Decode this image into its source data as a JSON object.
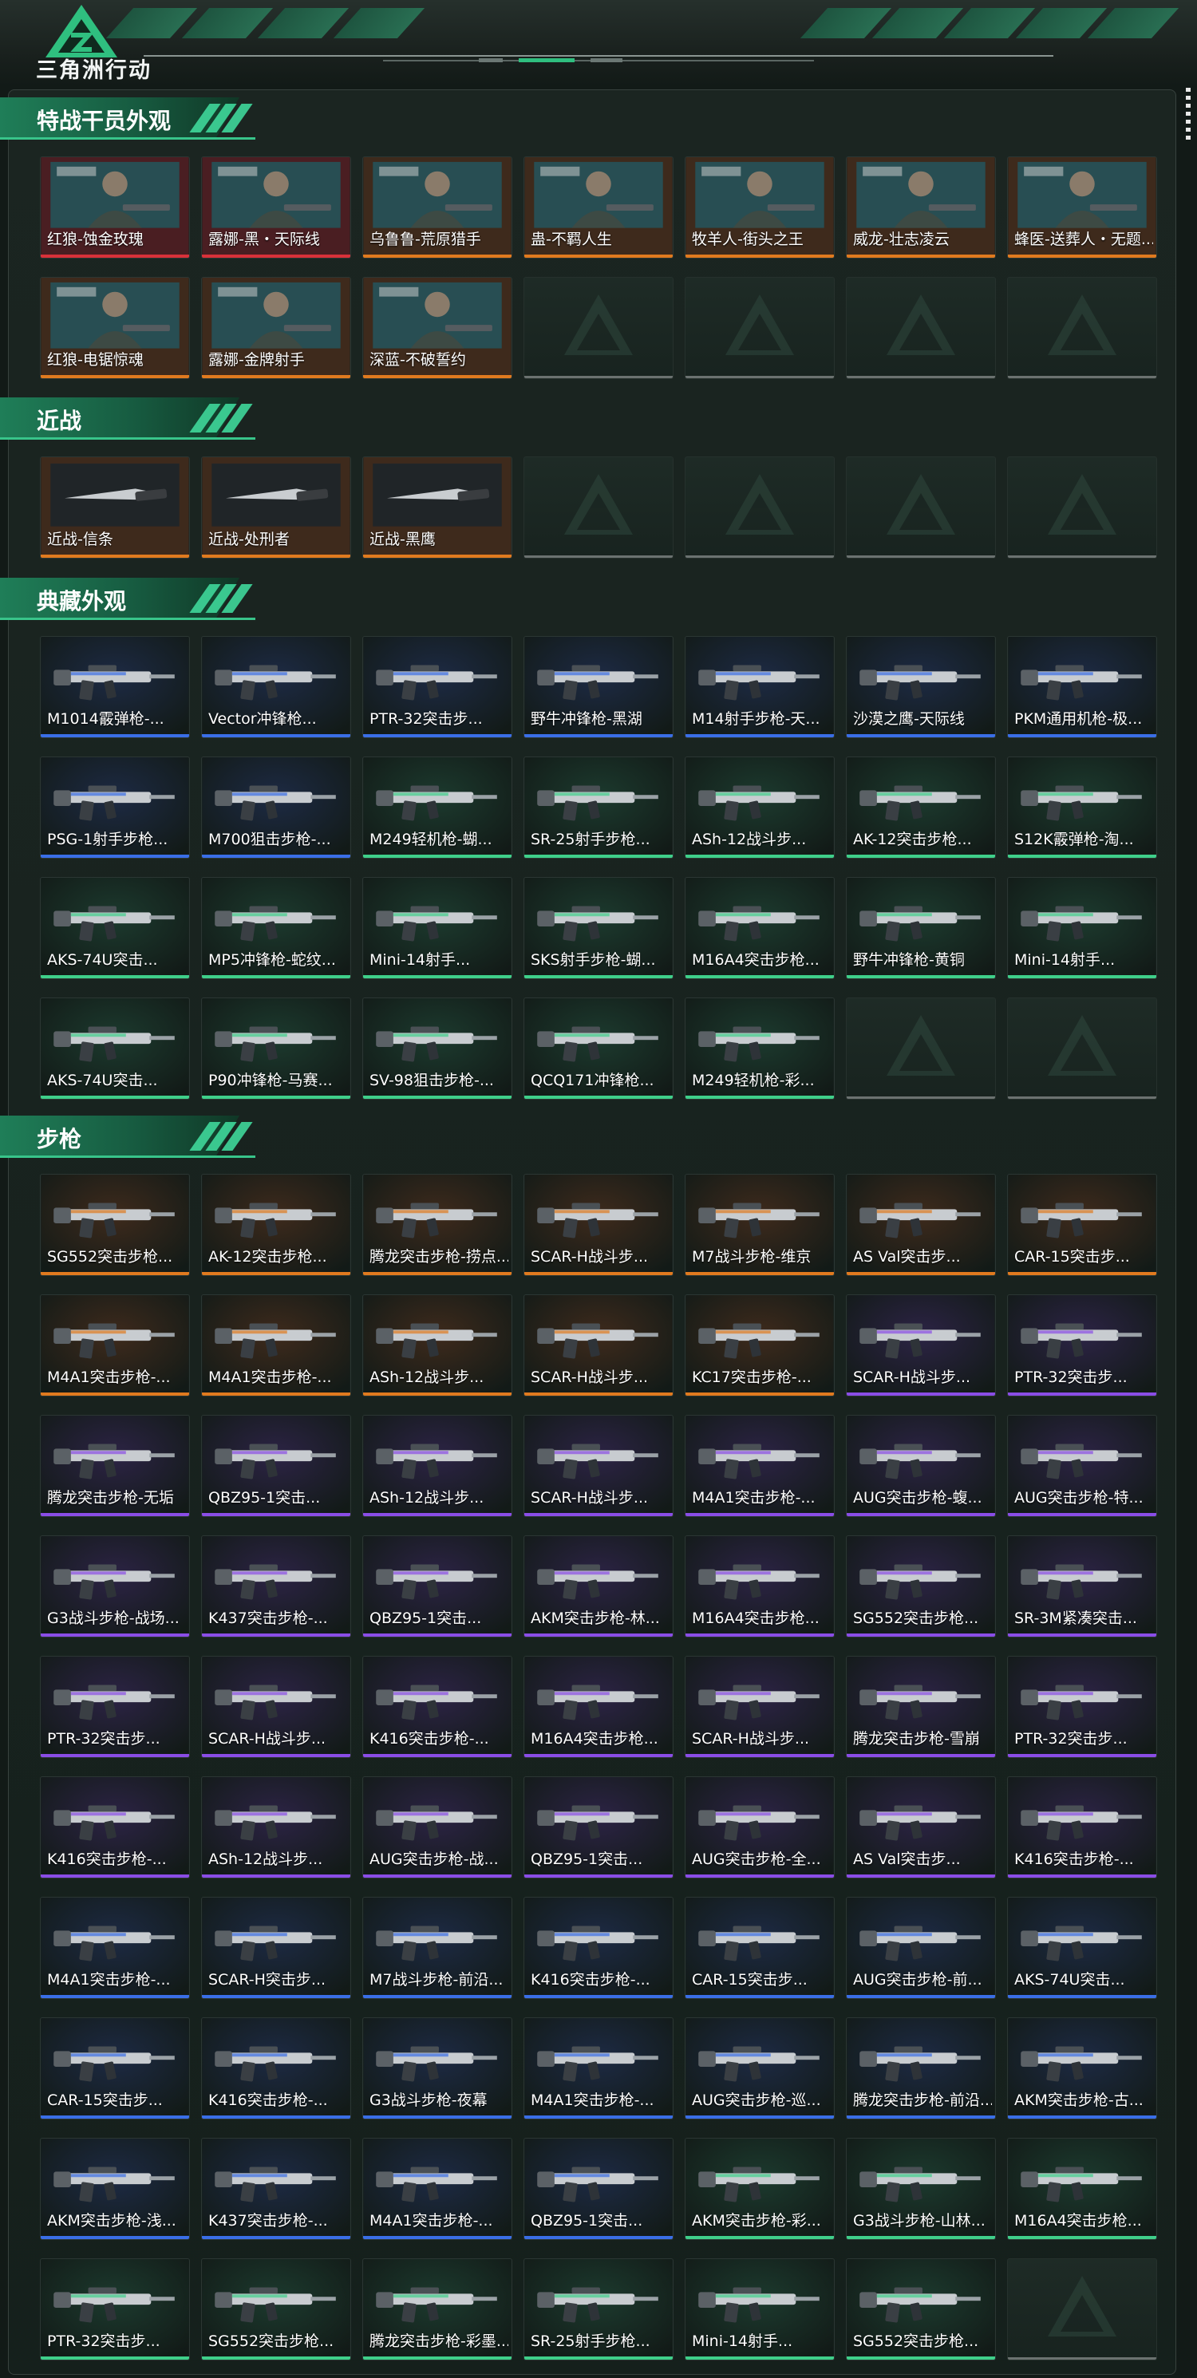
{
  "brand": {
    "title": "三角洲行动"
  },
  "colors": {
    "accent": "#2fbf7f",
    "rarity": {
      "red": "#d8313a",
      "orange": "#e07a1f",
      "purple": "#8a4de6",
      "blue": "#3a6ee6",
      "green": "#3fcf8a",
      "empty": "#6b7270"
    },
    "bg": {
      "red": "#4a1e22",
      "orange": "#3e2a1c",
      "purple": "#2c2345",
      "blue": "#1d2a44",
      "green": "#1c3a2e"
    }
  },
  "sections": [
    {
      "title": "特战干员外观",
      "items": [
        {
          "caption": "红狼-蚀金玫瑰",
          "rarity": "red",
          "icon": "operator-portrait"
        },
        {
          "caption": "露娜-黑・天际线",
          "rarity": "red",
          "icon": "operator-portrait"
        },
        {
          "caption": "乌鲁鲁-荒原猎手",
          "rarity": "orange",
          "icon": "operator-portrait"
        },
        {
          "caption": "蛊-不羁人生",
          "rarity": "orange",
          "icon": "operator-portrait"
        },
        {
          "caption": "牧羊人-街头之王",
          "rarity": "orange",
          "icon": "operator-portrait"
        },
        {
          "caption": "威龙-壮志凌云",
          "rarity": "orange",
          "icon": "operator-portrait"
        },
        {
          "caption": "蜂医-送葬人・无题...",
          "rarity": "orange",
          "icon": "operator-portrait"
        },
        {
          "caption": "红狼-电锯惊魂",
          "rarity": "orange",
          "icon": "operator-portrait"
        },
        {
          "caption": "露娜-金牌射手",
          "rarity": "orange",
          "icon": "operator-portrait"
        },
        {
          "caption": "深蓝-不破誓约",
          "rarity": "orange",
          "icon": "operator-portrait"
        },
        {
          "caption": "",
          "rarity": "empty",
          "icon": "empty-slot"
        },
        {
          "caption": "",
          "rarity": "empty",
          "icon": "empty-slot"
        },
        {
          "caption": "",
          "rarity": "empty",
          "icon": "empty-slot"
        },
        {
          "caption": "",
          "rarity": "empty",
          "icon": "empty-slot"
        }
      ]
    },
    {
      "title": "近战",
      "items": [
        {
          "caption": "近战-信条",
          "rarity": "orange",
          "icon": "knife-icon"
        },
        {
          "caption": "近战-处刑者",
          "rarity": "orange",
          "icon": "knife-icon"
        },
        {
          "caption": "近战-黑鹰",
          "rarity": "orange",
          "icon": "knife-icon"
        },
        {
          "caption": "",
          "rarity": "empty",
          "icon": "empty-slot"
        },
        {
          "caption": "",
          "rarity": "empty",
          "icon": "empty-slot"
        },
        {
          "caption": "",
          "rarity": "empty",
          "icon": "empty-slot"
        },
        {
          "caption": "",
          "rarity": "empty",
          "icon": "empty-slot"
        }
      ]
    },
    {
      "title": "典藏外观",
      "items": [
        {
          "caption": "M1014霰弹枪-...",
          "rarity": "blue",
          "icon": "gun-icon"
        },
        {
          "caption": "Vector冲锋枪...",
          "rarity": "blue",
          "icon": "gun-icon"
        },
        {
          "caption": "PTR-32突击步...",
          "rarity": "blue",
          "icon": "gun-icon"
        },
        {
          "caption": "野牛冲锋枪-黑湖",
          "rarity": "blue",
          "icon": "gun-icon"
        },
        {
          "caption": "M14射手步枪-天...",
          "rarity": "blue",
          "icon": "gun-icon"
        },
        {
          "caption": "沙漠之鹰-天际线",
          "rarity": "blue",
          "icon": "gun-icon"
        },
        {
          "caption": "PKM通用机枪-极...",
          "rarity": "blue",
          "icon": "gun-icon"
        },
        {
          "caption": "PSG-1射手步枪...",
          "rarity": "blue",
          "icon": "gun-icon"
        },
        {
          "caption": "M700狙击步枪-...",
          "rarity": "blue",
          "icon": "gun-icon"
        },
        {
          "caption": "M249轻机枪-蝴...",
          "rarity": "green",
          "icon": "gun-icon"
        },
        {
          "caption": "SR-25射手步枪...",
          "rarity": "green",
          "icon": "gun-icon"
        },
        {
          "caption": "ASh-12战斗步...",
          "rarity": "green",
          "icon": "gun-icon"
        },
        {
          "caption": "AK-12突击步枪...",
          "rarity": "green",
          "icon": "gun-icon"
        },
        {
          "caption": "S12K霰弹枪-淘...",
          "rarity": "green",
          "icon": "gun-icon"
        },
        {
          "caption": "AKS-74U突击...",
          "rarity": "green",
          "icon": "gun-icon"
        },
        {
          "caption": "MP5冲锋枪-蛇纹...",
          "rarity": "green",
          "icon": "gun-icon"
        },
        {
          "caption": "Mini-14射手...",
          "rarity": "green",
          "icon": "gun-icon"
        },
        {
          "caption": "SKS射手步枪-蝴...",
          "rarity": "green",
          "icon": "gun-icon"
        },
        {
          "caption": "M16A4突击步枪...",
          "rarity": "green",
          "icon": "gun-icon"
        },
        {
          "caption": "野牛冲锋枪-黄铜",
          "rarity": "green",
          "icon": "gun-icon"
        },
        {
          "caption": "Mini-14射手...",
          "rarity": "green",
          "icon": "gun-icon"
        },
        {
          "caption": "AKS-74U突击...",
          "rarity": "green",
          "icon": "gun-icon"
        },
        {
          "caption": "P90冲锋枪-马赛...",
          "rarity": "green",
          "icon": "gun-icon"
        },
        {
          "caption": "SV-98狙击步枪-...",
          "rarity": "green",
          "icon": "gun-icon"
        },
        {
          "caption": "QCQ171冲锋枪...",
          "rarity": "green",
          "icon": "gun-icon"
        },
        {
          "caption": "M249轻机枪-彩...",
          "rarity": "green",
          "icon": "gun-icon"
        },
        {
          "caption": "",
          "rarity": "empty",
          "icon": "empty-slot"
        },
        {
          "caption": "",
          "rarity": "empty",
          "icon": "empty-slot"
        }
      ]
    },
    {
      "title": "步枪",
      "items": [
        {
          "caption": "SG552突击步枪...",
          "rarity": "orange",
          "icon": "gun-icon"
        },
        {
          "caption": "AK-12突击步枪...",
          "rarity": "orange",
          "icon": "gun-icon"
        },
        {
          "caption": "腾龙突击步枪-捞点...",
          "rarity": "orange",
          "icon": "gun-icon"
        },
        {
          "caption": "SCAR-H战斗步...",
          "rarity": "orange",
          "icon": "gun-icon"
        },
        {
          "caption": "M7战斗步枪-维京",
          "rarity": "orange",
          "icon": "gun-icon"
        },
        {
          "caption": "AS Val突击步...",
          "rarity": "orange",
          "icon": "gun-icon"
        },
        {
          "caption": "CAR-15突击步...",
          "rarity": "orange",
          "icon": "gun-icon"
        },
        {
          "caption": "M4A1突击步枪-...",
          "rarity": "orange",
          "icon": "gun-icon"
        },
        {
          "caption": "M4A1突击步枪-...",
          "rarity": "orange",
          "icon": "gun-icon"
        },
        {
          "caption": "ASh-12战斗步...",
          "rarity": "orange",
          "icon": "gun-icon"
        },
        {
          "caption": "SCAR-H战斗步...",
          "rarity": "orange",
          "icon": "gun-icon"
        },
        {
          "caption": "KC17突击步枪-...",
          "rarity": "orange",
          "icon": "gun-icon"
        },
        {
          "caption": "SCAR-H战斗步...",
          "rarity": "purple",
          "icon": "gun-icon"
        },
        {
          "caption": "PTR-32突击步...",
          "rarity": "purple",
          "icon": "gun-icon"
        },
        {
          "caption": "腾龙突击步枪-无垢",
          "rarity": "purple",
          "icon": "gun-icon"
        },
        {
          "caption": "QBZ95-1突击...",
          "rarity": "purple",
          "icon": "gun-icon"
        },
        {
          "caption": "ASh-12战斗步...",
          "rarity": "purple",
          "icon": "gun-icon"
        },
        {
          "caption": "SCAR-H战斗步...",
          "rarity": "purple",
          "icon": "gun-icon"
        },
        {
          "caption": "M4A1突击步枪-...",
          "rarity": "purple",
          "icon": "gun-icon"
        },
        {
          "caption": "AUG突击步枪-蝮...",
          "rarity": "purple",
          "icon": "gun-icon"
        },
        {
          "caption": "AUG突击步枪-特...",
          "rarity": "purple",
          "icon": "gun-icon"
        },
        {
          "caption": "G3战斗步枪-战场...",
          "rarity": "purple",
          "icon": "gun-icon"
        },
        {
          "caption": "K437突击步枪-...",
          "rarity": "purple",
          "icon": "gun-icon"
        },
        {
          "caption": "QBZ95-1突击...",
          "rarity": "purple",
          "icon": "gun-icon"
        },
        {
          "caption": "AKM突击步枪-林...",
          "rarity": "purple",
          "icon": "gun-icon"
        },
        {
          "caption": "M16A4突击步枪...",
          "rarity": "purple",
          "icon": "gun-icon"
        },
        {
          "caption": "SG552突击步枪...",
          "rarity": "purple",
          "icon": "gun-icon"
        },
        {
          "caption": "SR-3M紧凑突击...",
          "rarity": "purple",
          "icon": "gun-icon"
        },
        {
          "caption": "PTR-32突击步...",
          "rarity": "purple",
          "icon": "gun-icon"
        },
        {
          "caption": "SCAR-H战斗步...",
          "rarity": "purple",
          "icon": "gun-icon"
        },
        {
          "caption": "K416突击步枪-...",
          "rarity": "purple",
          "icon": "gun-icon"
        },
        {
          "caption": "M16A4突击步枪...",
          "rarity": "purple",
          "icon": "gun-icon"
        },
        {
          "caption": "SCAR-H战斗步...",
          "rarity": "purple",
          "icon": "gun-icon"
        },
        {
          "caption": "腾龙突击步枪-雪崩",
          "rarity": "purple",
          "icon": "gun-icon"
        },
        {
          "caption": "PTR-32突击步...",
          "rarity": "purple",
          "icon": "gun-icon"
        },
        {
          "caption": "K416突击步枪-...",
          "rarity": "purple",
          "icon": "gun-icon"
        },
        {
          "caption": "ASh-12战斗步...",
          "rarity": "purple",
          "icon": "gun-icon"
        },
        {
          "caption": "AUG突击步枪-战...",
          "rarity": "purple",
          "icon": "gun-icon"
        },
        {
          "caption": "QBZ95-1突击...",
          "rarity": "purple",
          "icon": "gun-icon"
        },
        {
          "caption": "AUG突击步枪-全...",
          "rarity": "purple",
          "icon": "gun-icon"
        },
        {
          "caption": "AS Val突击步...",
          "rarity": "purple",
          "icon": "gun-icon"
        },
        {
          "caption": "K416突击步枪-...",
          "rarity": "purple",
          "icon": "gun-icon"
        },
        {
          "caption": "M4A1突击步枪-...",
          "rarity": "blue",
          "icon": "gun-icon"
        },
        {
          "caption": "SCAR-H突击步...",
          "rarity": "blue",
          "icon": "gun-icon"
        },
        {
          "caption": "M7战斗步枪-前沿...",
          "rarity": "blue",
          "icon": "gun-icon"
        },
        {
          "caption": "K416突击步枪-...",
          "rarity": "blue",
          "icon": "gun-icon"
        },
        {
          "caption": "CAR-15突击步...",
          "rarity": "blue",
          "icon": "gun-icon"
        },
        {
          "caption": "AUG突击步枪-前...",
          "rarity": "blue",
          "icon": "gun-icon"
        },
        {
          "caption": "AKS-74U突击...",
          "rarity": "blue",
          "icon": "gun-icon"
        },
        {
          "caption": "CAR-15突击步...",
          "rarity": "blue",
          "icon": "gun-icon"
        },
        {
          "caption": "K416突击步枪-...",
          "rarity": "blue",
          "icon": "gun-icon"
        },
        {
          "caption": "G3战斗步枪-夜幕",
          "rarity": "blue",
          "icon": "gun-icon"
        },
        {
          "caption": "M4A1突击步枪-...",
          "rarity": "blue",
          "icon": "gun-icon"
        },
        {
          "caption": "AUG突击步枪-巡...",
          "rarity": "blue",
          "icon": "gun-icon"
        },
        {
          "caption": "腾龙突击步枪-前沿...",
          "rarity": "blue",
          "icon": "gun-icon"
        },
        {
          "caption": "AKM突击步枪-古...",
          "rarity": "blue",
          "icon": "gun-icon"
        },
        {
          "caption": "AKM突击步枪-浅...",
          "rarity": "blue",
          "icon": "gun-icon"
        },
        {
          "caption": "K437突击步枪-...",
          "rarity": "blue",
          "icon": "gun-icon"
        },
        {
          "caption": "M4A1突击步枪-...",
          "rarity": "blue",
          "icon": "gun-icon"
        },
        {
          "caption": "QBZ95-1突击...",
          "rarity": "blue",
          "icon": "gun-icon"
        },
        {
          "caption": "AKM突击步枪-彩...",
          "rarity": "green",
          "icon": "gun-icon"
        },
        {
          "caption": "G3战斗步枪-山林...",
          "rarity": "green",
          "icon": "gun-icon"
        },
        {
          "caption": "M16A4突击步枪...",
          "rarity": "green",
          "icon": "gun-icon"
        },
        {
          "caption": "PTR-32突击步...",
          "rarity": "green",
          "icon": "gun-icon"
        },
        {
          "caption": "SG552突击步枪...",
          "rarity": "green",
          "icon": "gun-icon"
        },
        {
          "caption": "腾龙突击步枪-彩墨...",
          "rarity": "green",
          "icon": "gun-icon"
        },
        {
          "caption": "SR-25射手步枪...",
          "rarity": "green",
          "icon": "gun-icon"
        },
        {
          "caption": "Mini-14射手...",
          "rarity": "green",
          "icon": "gun-icon"
        },
        {
          "caption": "SG552突击步枪...",
          "rarity": "green",
          "icon": "gun-icon"
        },
        {
          "caption": "",
          "rarity": "empty",
          "icon": "empty-slot"
        }
      ]
    }
  ]
}
